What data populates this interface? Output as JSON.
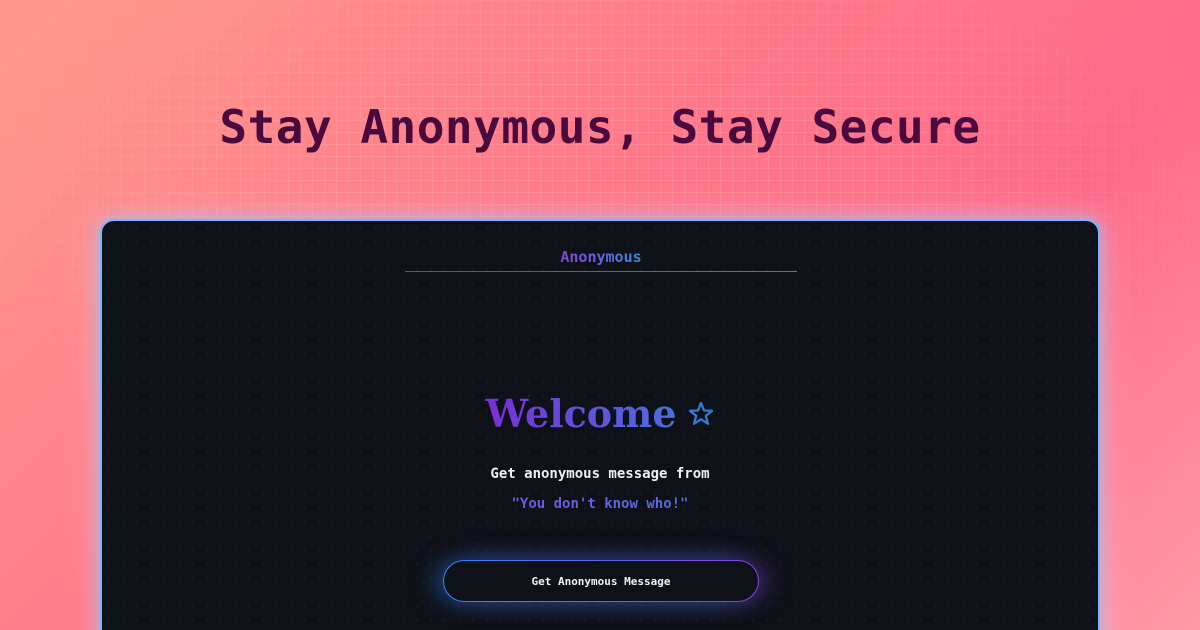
{
  "hero": {
    "title": "Stay Anonymous, Stay Secure"
  },
  "nav": {
    "brand": "Anonymous"
  },
  "main": {
    "welcome": "Welcome",
    "welcome_icon": "star-outline-icon",
    "subtitle": "Get anonymous message from",
    "quote": "\"You don't know who!\"",
    "cta_label": "Get Anonymous Message"
  },
  "colors": {
    "background_gradient": [
      "#ff9a8b",
      "#ff6b88"
    ],
    "hero_text": "#4a0a3e",
    "window_bg": "#0e1117",
    "accent_purple": "#7b2fd6",
    "accent_blue": "#2a8cff",
    "window_border": "#7ab6ff"
  }
}
